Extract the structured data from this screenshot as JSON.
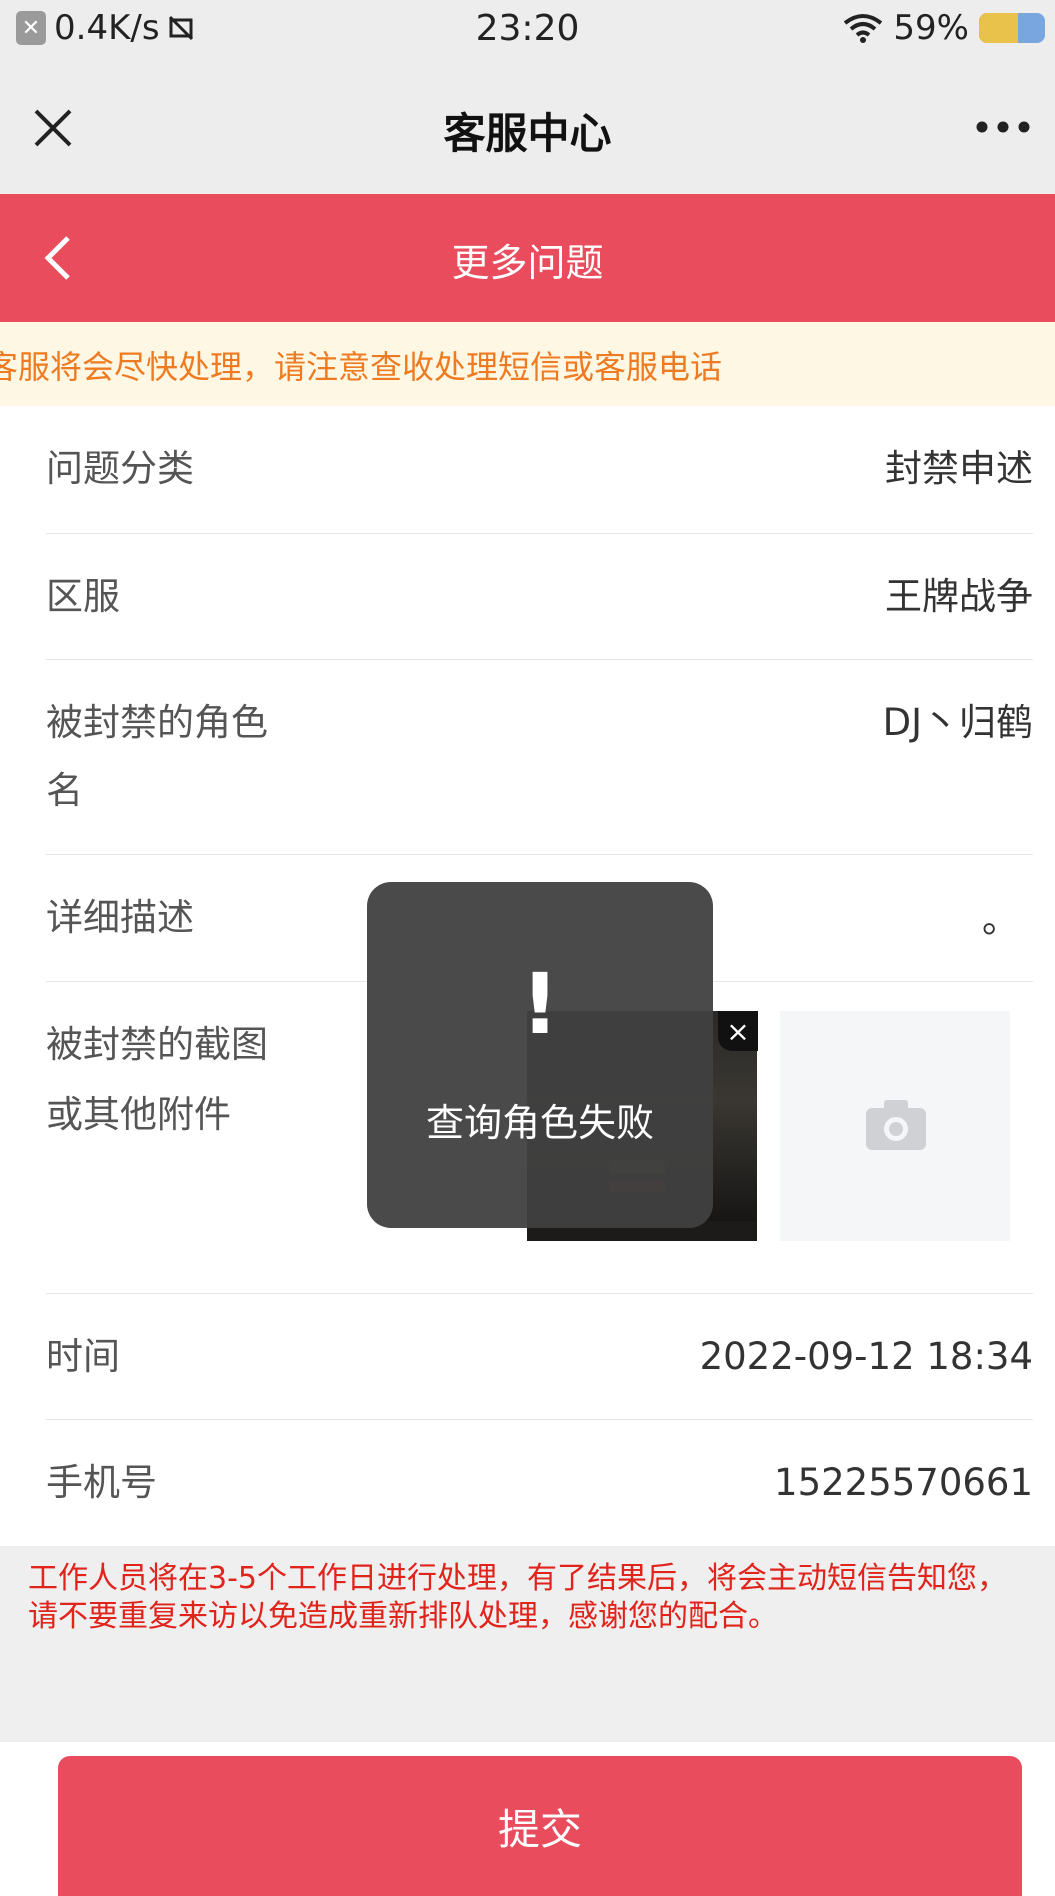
{
  "status_bar": {
    "speed": "0.4K/s",
    "time": "23:20",
    "battery": "59%",
    "battery_level": 0.59
  },
  "nav": {
    "title": "客服中心"
  },
  "header": {
    "title": "更多问题"
  },
  "notice": {
    "text": "客服将会尽快处理，请注意查收处理短信或客服电话"
  },
  "form": {
    "category": {
      "label": "问题分类",
      "value": "封禁申述"
    },
    "server": {
      "label": "区服",
      "value": "王牌战争"
    },
    "role": {
      "label_line1": "被封禁的角色",
      "label_line2": "名",
      "value": "DJ丶归鹤"
    },
    "description": {
      "label": "详细描述",
      "value": "。"
    },
    "attachment": {
      "label_line1": "被封禁的截图",
      "label_line2": "或其他附件"
    },
    "time": {
      "label": "时间",
      "value": "2022-09-12 18:34"
    },
    "phone": {
      "label": "手机号",
      "value": "15225570661"
    }
  },
  "toast": {
    "icon": "!",
    "message": "查询角色失败"
  },
  "warning": "工作人员将在3-5个工作日进行处理，有了结果后，将会主动短信告知您，请不要重复来访以免造成重新排队处理，感谢您的配合。",
  "submit_label": "提交",
  "icons": {
    "close": "close-icon",
    "more": "more-icon",
    "back": "back-icon",
    "camera": "camera-icon"
  },
  "colors": {
    "brand_red": "#e84c5d",
    "notice_orange": "#ee7b21",
    "warning_red": "#e0231b"
  }
}
